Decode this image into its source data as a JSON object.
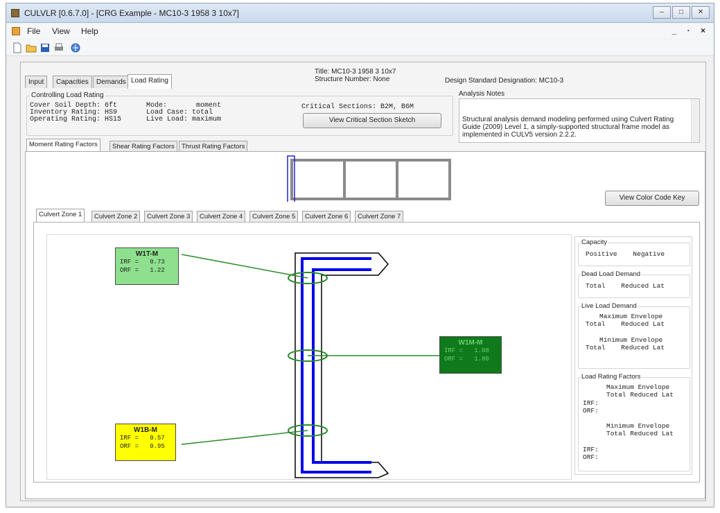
{
  "window": {
    "title": "CULVLR [0.6.7.0] - [CRG Example - MC10-3 1958 3 10x7]",
    "minimize": "–",
    "maximize": "□",
    "close": "✕"
  },
  "menu": {
    "items": [
      "File",
      "View",
      "Help"
    ],
    "mdi_controls": "_ · ×"
  },
  "header": {
    "title_line": "Title: MC10-3 1958 3 10x7",
    "structure_line": "Structure Number: None",
    "design_standard": "Design Standard Designation: MC10-3"
  },
  "tabs": [
    "Input",
    "Capacities",
    "Demands",
    "Load Rating"
  ],
  "controlling": {
    "group_label": "Controlling Load Rating",
    "lines": [
      "Cover Soil Depth: 6ft       Mode:       moment",
      "Inventory Rating: HS9       Load Case: total",
      "Operating Rating: HS15      Live Load: maximum"
    ],
    "critical_sections": "Critical Sections: B2M, B6M",
    "view_critical_button": "View Critical Section Sketch"
  },
  "analysis_notes": {
    "label": "Analysis Notes",
    "text": "Structural analysis demand modeling performed using Culvert Rating Guide (2009) Level 1, a simply-supported structural frame model as implemented in CULV5 version 2.2.2."
  },
  "rating_tabs": [
    "Moment Rating Factors",
    "Shear Rating Factors",
    "Thrust Rating Factors"
  ],
  "view_color_key_button": "View Color Code Key",
  "zone_tabs": [
    "Culvert Zone 1",
    "Culvert Zone 2",
    "Culvert Zone 3",
    "Culvert Zone 4",
    "Culvert Zone 5",
    "Culvert Zone 6",
    "Culvert Zone 7"
  ],
  "rating_boxes": [
    {
      "id": "W1T-M",
      "irf_label": "IRF =",
      "irf": "0.73",
      "orf_label": "ORF =",
      "orf": "1.22",
      "color": "#8ee08e"
    },
    {
      "id": "W1M-M",
      "irf_label": "IRF =",
      "irf": "1.08",
      "orf_label": "ORF =",
      "orf": "1.80",
      "color": "#0f7a1c"
    },
    {
      "id": "W1B-M",
      "irf_label": "IRF =",
      "irf": "0.57",
      "orf_label": "ORF =",
      "orf": "0.95",
      "color": "#ffff00"
    }
  ],
  "right_panel": {
    "capacity": {
      "label": "Capacity",
      "cols": "Positive    Negative"
    },
    "dead_load": {
      "label": "Dead Load Demand",
      "cols": "Total    Reduced Lat"
    },
    "live_load": {
      "label": "Live Load Demand",
      "max_env": "Maximum Envelope",
      "max_cols": "Total    Reduced Lat",
      "min_env": "Minimum Envelope",
      "min_cols": "Total    Reduced Lat"
    },
    "lrf": {
      "label": "Load Rating Factors",
      "max_env": "Maximum Envelope",
      "max_cols": "Total Reduced Lat",
      "irf1": "IRF:",
      "orf1": "ORF:",
      "min_env": "Minimum Envelope",
      "min_cols": "Total Reduced Lat",
      "irf2": "IRF:",
      "orf2": "ORF:"
    }
  },
  "colors": {
    "member_outline": "#000000",
    "rebar": "#0000ee",
    "section_marker": "#2a8a2a",
    "overview_frame": "#8a8a8a",
    "overview_select": "#2222cc"
  }
}
